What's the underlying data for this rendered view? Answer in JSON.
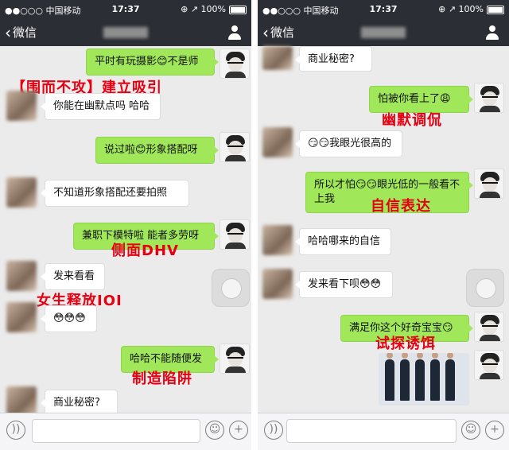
{
  "status": {
    "carrier": "●●○○○ 中国移动",
    "time": "17:37",
    "battery": "⊕ ↗ 100%"
  },
  "nav": {
    "back_label": "微信",
    "back_icon": "chevron-left",
    "contact_icon": "person"
  },
  "left": {
    "messages": [
      {
        "text": "平时有玩摄影😊不是师"
      },
      {
        "text": "你能在幽默点吗 哈哈"
      },
      {
        "text": "说过啦😊形象搭配呀"
      },
      {
        "text": "不知道形象搭配还要拍照"
      },
      {
        "text": "兼职下模特啦 能者多劳呀"
      },
      {
        "text": "发来看看"
      },
      {
        "text": "😳😳😳"
      },
      {
        "text": "哈哈不能随便发"
      },
      {
        "text": "商业秘密?"
      }
    ],
    "annotations": [
      "【围而不攻】建立吸引",
      "侧面DHV",
      "女生释放IOI",
      "制造陷阱"
    ]
  },
  "right": {
    "messages": [
      {
        "text": "商业秘密?"
      },
      {
        "text": "怕被你看上了😩"
      },
      {
        "text": "😏😏我眼光很高的"
      },
      {
        "text": "所以才怕😏😏眼光低的一般看不上我"
      },
      {
        "text": "哈哈哪来的自信"
      },
      {
        "text": "发来看下呗😳😳"
      },
      {
        "text": "满足你这个好奇宝宝😏"
      }
    ],
    "annotations": [
      "幽默调侃",
      "自信表达",
      "试探诱饵"
    ]
  },
  "input": {
    "voice_icon": "voice-icon",
    "emoji_icon": "emoji-icon",
    "plus_label": "+"
  },
  "colors": {
    "header": "#2b2e34",
    "chat_bg": "#ebebeb",
    "sent_bubble": "#a0e75a",
    "annotation": "#e60012"
  }
}
